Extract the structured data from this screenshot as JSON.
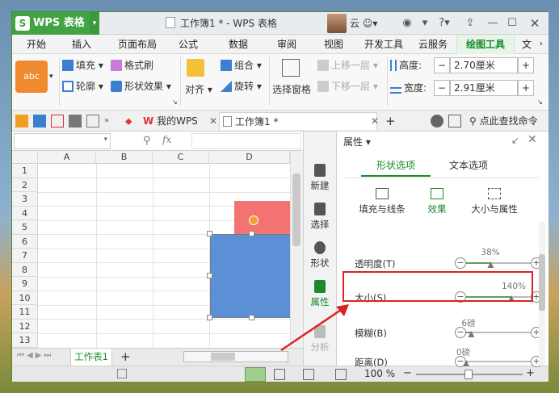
{
  "app": {
    "name": "WPS 表格",
    "doc_title": "工作簿1 * - WPS 表格",
    "user": "云",
    "help": "?"
  },
  "menu": {
    "tabs": [
      "开始",
      "插入",
      "页面布局",
      "公式",
      "数据",
      "审阅",
      "视图",
      "开发工具",
      "云服务",
      "绘图工具",
      "文"
    ],
    "active": "绘图工具"
  },
  "ribbon": {
    "shape_style": "abc",
    "fill": "填充",
    "format_brush": "格式刷",
    "outline": "轮廓",
    "shape_effect": "形状效果",
    "align": "对齐",
    "group": "组合",
    "rotate": "旋转",
    "selection_pane": "选择窗格",
    "bring_forward": "上移一层",
    "send_backward": "下移一层",
    "height_label": "高度:",
    "height_value": "2.70厘米",
    "width_label": "宽度:",
    "width_value": "2.91厘米",
    "minus": "−",
    "plus": "+"
  },
  "quickbar": {
    "my_wps": "我的WPS",
    "doc_tab": "工作簿1 *",
    "find_cmd": "点此查找命令"
  },
  "formula": {
    "fx": "fx"
  },
  "grid": {
    "columns": [
      "A",
      "B",
      "C",
      "D"
    ],
    "rows": [
      "1",
      "2",
      "3",
      "4",
      "5",
      "6",
      "7",
      "8",
      "9",
      "10",
      "11",
      "12",
      "13"
    ]
  },
  "sheetbar": {
    "sheet_tab": "工作表1",
    "add": "+"
  },
  "statusbar": {
    "zoom": "100 %"
  },
  "sidetask": {
    "items": [
      "新建",
      "选择",
      "形状",
      "属性",
      "分析"
    ],
    "active": "属性"
  },
  "props": {
    "title": "属性",
    "tabs": [
      "形状选项",
      "文本选项"
    ],
    "active_tab": "形状选项",
    "subtabs": [
      "填充与线条",
      "效果",
      "大小与属性"
    ],
    "active_subtab": "效果",
    "rows": [
      {
        "label": "透明度(T)",
        "value": "38%",
        "level": 0.38
      },
      {
        "label": "大小(S)",
        "value": "140%",
        "level": 0.7
      },
      {
        "label": "模糊(B)",
        "value": "6磅",
        "level": 0.08
      },
      {
        "label": "距离(D)",
        "value": "0磅",
        "level": 0.0
      }
    ]
  },
  "colors": {
    "wps_green": "#41a342",
    "accent_green": "#1a8a2a",
    "shape_blue": "#5b8fd6",
    "shape_red": "#f26a6a",
    "highlight_red": "#dd2222"
  }
}
